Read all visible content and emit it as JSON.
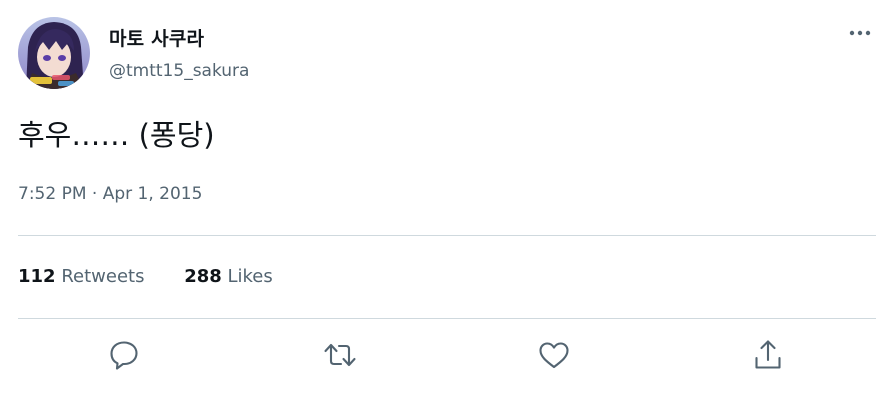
{
  "tweet": {
    "display_name": "마토 사쿠라",
    "handle": "@tmtt15_sakura",
    "text": "후우…… (퐁당)",
    "timestamp": "7:52 PM · Apr 1, 2015"
  },
  "stats": {
    "retweets_count": "112",
    "retweets_label": "Retweets",
    "likes_count": "288",
    "likes_label": "Likes"
  },
  "actions": [
    {
      "icon": "reply-icon"
    },
    {
      "icon": "retweet-icon"
    },
    {
      "icon": "like-icon"
    },
    {
      "icon": "share-icon"
    }
  ],
  "colors": {
    "text": "#0f1419",
    "secondary_text": "#536471",
    "divider": "#cfd9de"
  }
}
